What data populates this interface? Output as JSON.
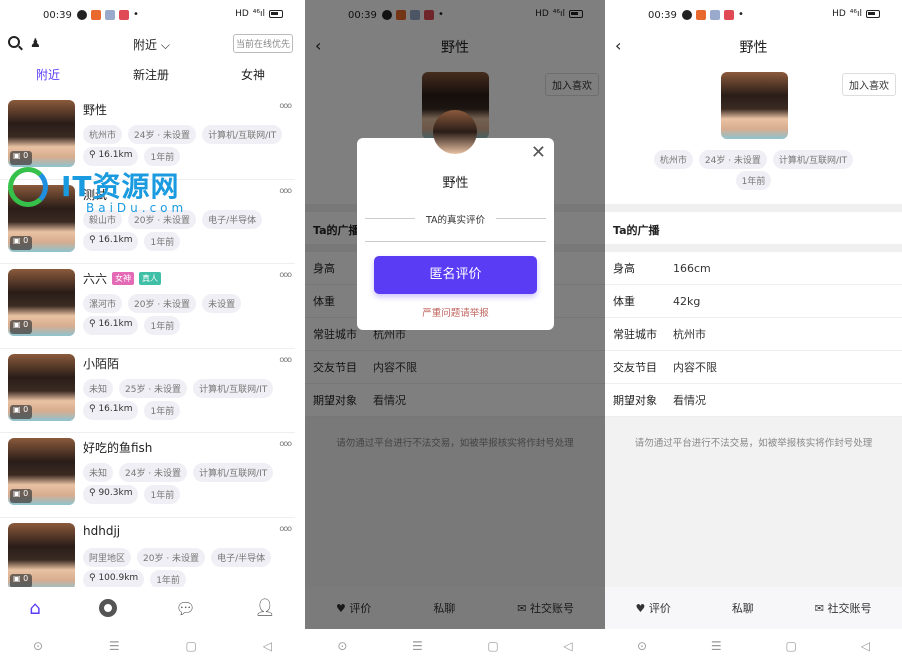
{
  "status": {
    "time": "00:39",
    "right_label": "HD",
    "signal": "⁴⁶ıl"
  },
  "list_screen": {
    "title": "附近",
    "online_filter": "当前在线优先",
    "tabs": [
      {
        "label": "附近",
        "active": true
      },
      {
        "label": "新注册"
      },
      {
        "label": "女神"
      }
    ],
    "watermark": {
      "text": "IT资源网",
      "sub": "BaiDu.com"
    },
    "users": [
      {
        "name": "野性",
        "tags": [
          "杭州市",
          "24岁 · 未设置",
          "计算机/互联网/IT"
        ],
        "distance": "16.1km",
        "time": "1年前",
        "photos": "0"
      },
      {
        "name": "测试",
        "tags": [
          "毅山市",
          "20岁 · 未设置",
          "电子/半导体"
        ],
        "distance": "16.1km",
        "time": "1年前",
        "photos": "0"
      },
      {
        "name": "六六",
        "badges": [
          {
            "label": "女神",
            "color": "#e46ab5"
          },
          {
            "label": "真人",
            "color": "#3fbfa6"
          }
        ],
        "tags": [
          "漯河市",
          "20岁 · 未设置",
          "未设置"
        ],
        "distance": "16.1km",
        "time": "1年前",
        "photos": "0"
      },
      {
        "name": "小陌陌",
        "tags": [
          "未知",
          "25岁 · 未设置",
          "计算机/互联网/IT"
        ],
        "distance": "16.1km",
        "time": "1年前",
        "photos": "0"
      },
      {
        "name": "好吃的鱼fish",
        "tags": [
          "未知",
          "24岁 · 未设置",
          "计算机/互联网/IT"
        ],
        "distance": "90.3km",
        "time": "1年前",
        "photos": "0"
      },
      {
        "name": "hdhdjj",
        "tags": [
          "阿里地区",
          "20岁 · 未设置",
          "电子/半导体"
        ],
        "distance": "100.9km",
        "time": "1年前",
        "photos": "0"
      }
    ],
    "bottom_nav": [
      {
        "icon": "home-icon",
        "active": true
      },
      {
        "icon": "discover-icon"
      },
      {
        "icon": "chat-icon"
      },
      {
        "icon": "profile-icon"
      }
    ],
    "accent": "#5b3cf5"
  },
  "detail": {
    "title": "野性",
    "like_button": "加入喜欢",
    "tags": [
      "杭州市",
      "24岁 · 未设置",
      "计算机/互联网/IT"
    ],
    "time": "1年前",
    "broadcast_label": "Ta的广播",
    "fields": [
      {
        "k": "身高",
        "v": "166cm"
      },
      {
        "k": "体重",
        "v": "42kg"
      },
      {
        "k": "常驻城市",
        "v": "杭州市"
      },
      {
        "k": "交友节目",
        "v": "内容不限"
      },
      {
        "k": "期望对象",
        "v": "看情况"
      }
    ],
    "notice": "请勿通过平台进行不法交易，如被举报核实将作封号处理",
    "actions": {
      "review": "评价",
      "chat": "私聊",
      "social": "社交账号"
    }
  },
  "modal": {
    "name": "野性",
    "divider": "TA的真实评价",
    "button": "匿名评价",
    "report": "严重问题请举报"
  }
}
